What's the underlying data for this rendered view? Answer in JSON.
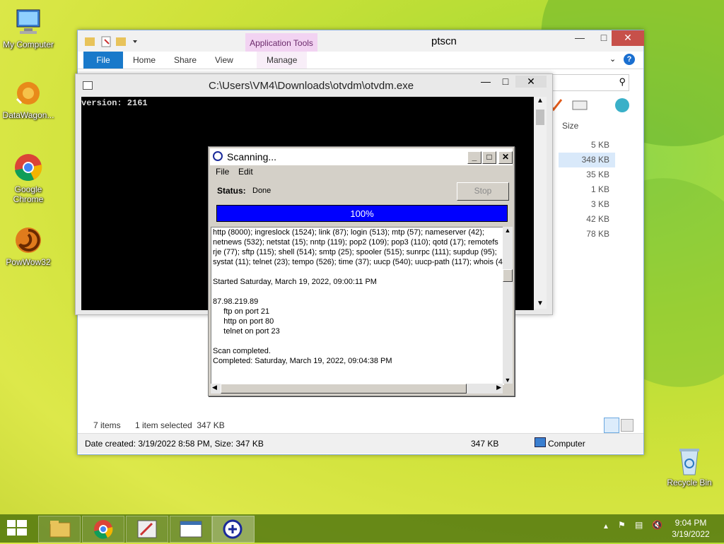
{
  "desktop": {
    "icons": [
      {
        "label": "My Computer"
      },
      {
        "label": "DataWagon..."
      },
      {
        "label": "Google Chrome"
      },
      {
        "label": "PowWow32"
      },
      {
        "label": "Recycle Bin"
      }
    ]
  },
  "explorer": {
    "title": "ptscn",
    "context_tab": "Application Tools",
    "ribbon_tabs": [
      "File",
      "Home",
      "Share",
      "View",
      "Manage"
    ],
    "column_header": "Size",
    "sizes": [
      "5 KB",
      "348 KB",
      "35 KB",
      "1 KB",
      "3 KB",
      "42 KB",
      "78 KB"
    ],
    "status": {
      "items": "7 items",
      "selected": "1 item selected  347 KB"
    },
    "details": {
      "created": "Date created: 3/19/2022 8:58 PM, Size: 347 KB",
      "size": "347 KB",
      "location": "Computer"
    }
  },
  "console": {
    "title": "C:\\Users\\VM4\\Downloads\\otvdm\\otvdm.exe",
    "output": "version: 2161"
  },
  "scan": {
    "title": "Scanning...",
    "menu": [
      "File",
      "Edit"
    ],
    "status_label": "Status:",
    "status_value": "Done",
    "stop_label": "Stop",
    "progress_text": "100%",
    "progress": 1.0,
    "log": [
      "http (8000); ingreslock (1524); link (87); login (513); mtp (57); nameserver (42);",
      "netnews (532); netstat (15); nntp (119); pop2 (109); pop3 (110); qotd (17); remotefs",
      "rje (77); sftp (115); shell (514); smtp (25); spooler (515); sunrpc (111); supdup (95);",
      "systat (11); telnet (23); tempo (526); time (37); uucp (540); uucp-path (117); whois (4",
      "",
      "Started Saturday, March 19, 2022, 09:00:11 PM",
      "",
      "87.98.219.89",
      "     ftp on port 21",
      "     http on port 80",
      "     telnet on port 23",
      "",
      "Scan completed.",
      "Completed: Saturday, March 19, 2022, 09:04:38 PM"
    ]
  },
  "taskbar": {
    "time": "9:04 PM",
    "date": "3/19/2022"
  }
}
